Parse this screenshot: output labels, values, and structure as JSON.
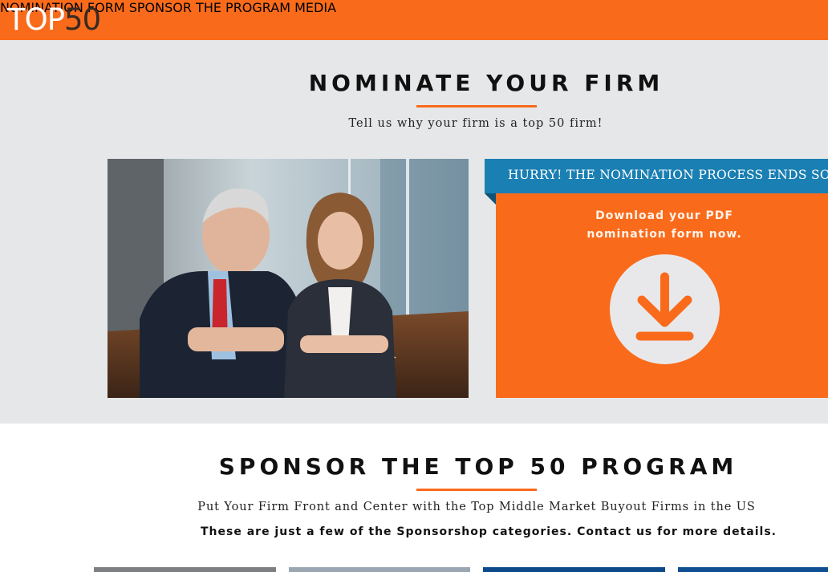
{
  "header": {
    "logo_part1": "TOP",
    "logo_part2": "50",
    "nav": [
      "NOMINATION FORM",
      "SPONSOR THE PROGRAM",
      "MEDIA"
    ]
  },
  "nominate": {
    "title": "NOMINATE YOUR FIRM",
    "subtitle": "Tell us why your firm is a top 50 firm!",
    "banner": "HURRY! THE NOMINATION PROCESS ENDS SOON!",
    "download_line1": "Download your PDF",
    "download_line2": "nomination form now."
  },
  "sponsor": {
    "title": "SPONSOR THE TOP 50 PROGRAM",
    "subtitle": "Put Your Firm Front and Center with the Top Middle Market Buyout Firms in the US",
    "note": "These are just a few of the Sponsorshop categories. Contact us for more details."
  },
  "colors": {
    "accent": "#f96b1b",
    "banner_blue": "#1a7fb3",
    "section_gray": "#e6e7e9"
  },
  "icons": [
    "download-icon"
  ]
}
